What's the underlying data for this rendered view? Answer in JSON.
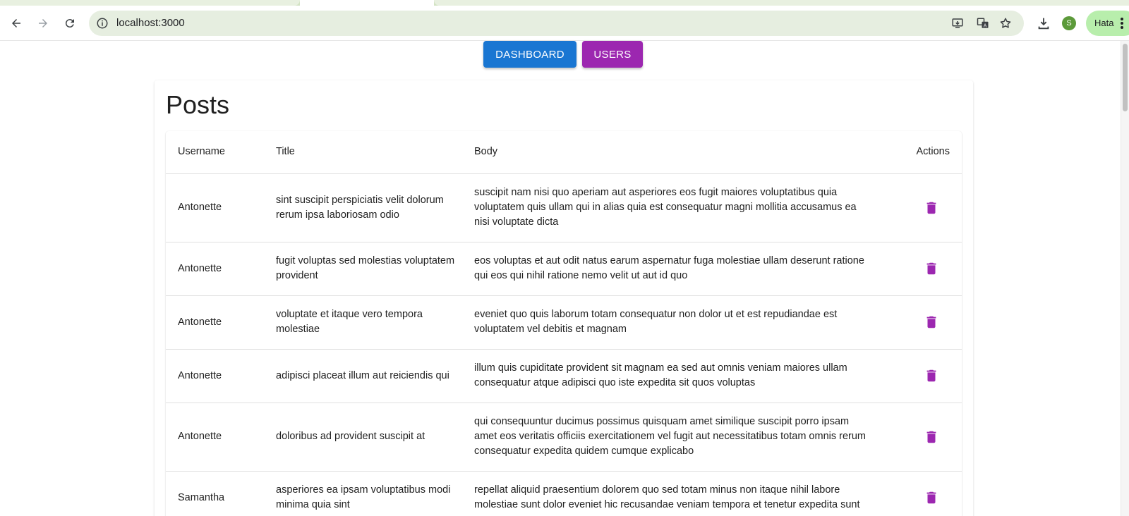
{
  "browser": {
    "url": "localhost:3000",
    "avatar_letter": "S",
    "error_label": "Hata"
  },
  "nav": {
    "dashboard_label": "DASHBOARD",
    "users_label": "USERS"
  },
  "colors": {
    "dashboard": "#1976d2",
    "users": "#9c27b0",
    "delete_icon": "#9c27b0"
  },
  "page": {
    "title": "Posts"
  },
  "table": {
    "headers": [
      "Username",
      "Title",
      "Body",
      "Actions"
    ],
    "rows": [
      {
        "username": "Antonette",
        "title": "sint suscipit perspiciatis velit dolorum rerum ipsa laboriosam odio",
        "body": "suscipit nam nisi quo aperiam aut asperiores eos fugit maiores voluptatibus quia voluptatem quis ullam qui in alias quia est consequatur magni mollitia accusamus ea nisi voluptate dicta"
      },
      {
        "username": "Antonette",
        "title": "fugit voluptas sed molestias voluptatem provident",
        "body": "eos voluptas et aut odit natus earum aspernatur fuga molestiae ullam deserunt ratione qui eos qui nihil ratione nemo velit ut aut id quo"
      },
      {
        "username": "Antonette",
        "title": "voluptate et itaque vero tempora molestiae",
        "body": "eveniet quo quis laborum totam consequatur non dolor ut et est repudiandae est voluptatem vel debitis et magnam"
      },
      {
        "username": "Antonette",
        "title": "adipisci placeat illum aut reiciendis qui",
        "body": "illum quis cupiditate provident sit magnam ea sed aut omnis veniam maiores ullam consequatur atque adipisci quo iste expedita sit quos voluptas"
      },
      {
        "username": "Antonette",
        "title": "doloribus ad provident suscipit at",
        "body": "qui consequuntur ducimus possimus quisquam amet similique suscipit porro ipsam amet eos veritatis officiis exercitationem vel fugit aut necessitatibus totam omnis rerum consequatur expedita quidem cumque explicabo"
      },
      {
        "username": "Samantha",
        "title": "asperiores ea ipsam voluptatibus modi minima quia sint",
        "body": "repellat aliquid praesentium dolorem quo sed totam minus non itaque nihil labore molestiae sunt dolor eveniet hic recusandae veniam tempora et tenetur expedita sunt"
      }
    ]
  }
}
